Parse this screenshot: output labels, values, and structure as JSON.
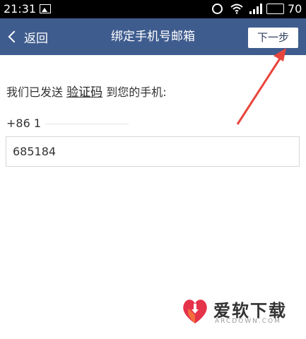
{
  "status_bar": {
    "time": "21:31",
    "battery": "70",
    "icons": [
      "image-icon",
      "alarm-icon",
      "wifi-icon",
      "signal-icon",
      "battery-icon"
    ]
  },
  "nav": {
    "back_label": "返回",
    "title": "绑定手机号邮箱",
    "next_label": "下一步",
    "background_color": "#3f5c8e"
  },
  "content": {
    "sent_prefix": "我们已发送",
    "sent_link": "验证码",
    "sent_suffix": "到您的手机:",
    "phone_prefix": "+86  1",
    "code_value": "685184"
  },
  "watermark": {
    "title": "爱软下载",
    "subtitle": "ARCDOWN.COM"
  },
  "annotation": {
    "arrow_color": "#e8453c"
  }
}
